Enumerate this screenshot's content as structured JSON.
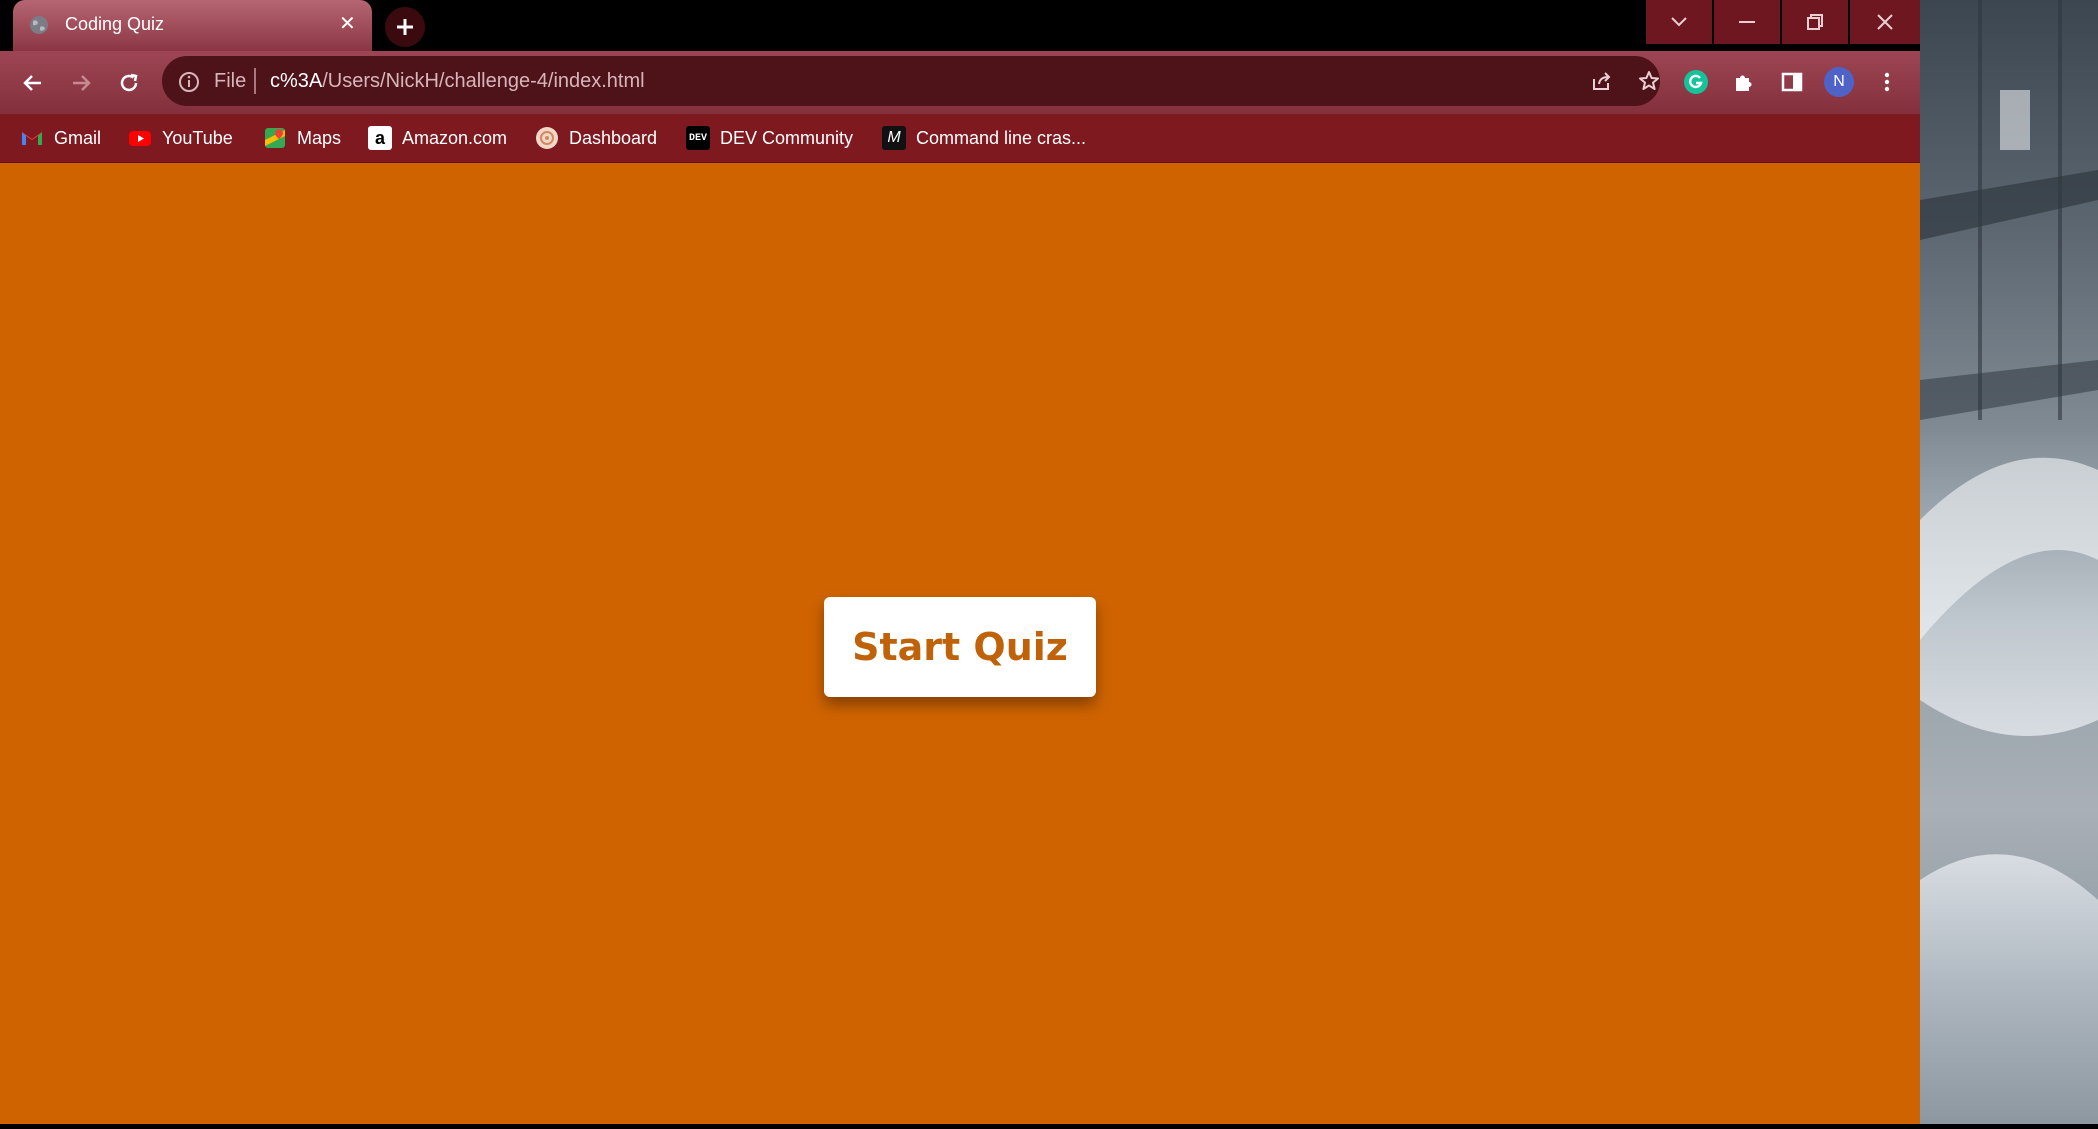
{
  "browser": {
    "tab": {
      "title": "Coding Quiz"
    },
    "omnibox": {
      "scheme_label": "File",
      "url_host": "c%3A",
      "url_path": "/Users/NickH/challenge-4/index.html"
    },
    "profile": {
      "initial": "N"
    },
    "bookmarks": [
      {
        "label": "Gmail",
        "icon": "gmail-icon"
      },
      {
        "label": "YouTube",
        "icon": "youtube-icon"
      },
      {
        "label": "Maps",
        "icon": "maps-icon"
      },
      {
        "label": "Amazon.com",
        "icon": "amazon-icon"
      },
      {
        "label": "Dashboard",
        "icon": "dashboard-icon"
      },
      {
        "label": "DEV Community",
        "icon": "dev-icon"
      },
      {
        "label": "Command line cras...",
        "icon": "command-line-icon"
      }
    ],
    "dev_icon_text": "DEV",
    "command_icon_text": "M",
    "amazon_icon_text": "a",
    "colors": {
      "page_background": "#cf6300",
      "button_text": "#c0620a",
      "frame": "#84303c"
    }
  },
  "page": {
    "start_button_label": "Start Quiz"
  }
}
